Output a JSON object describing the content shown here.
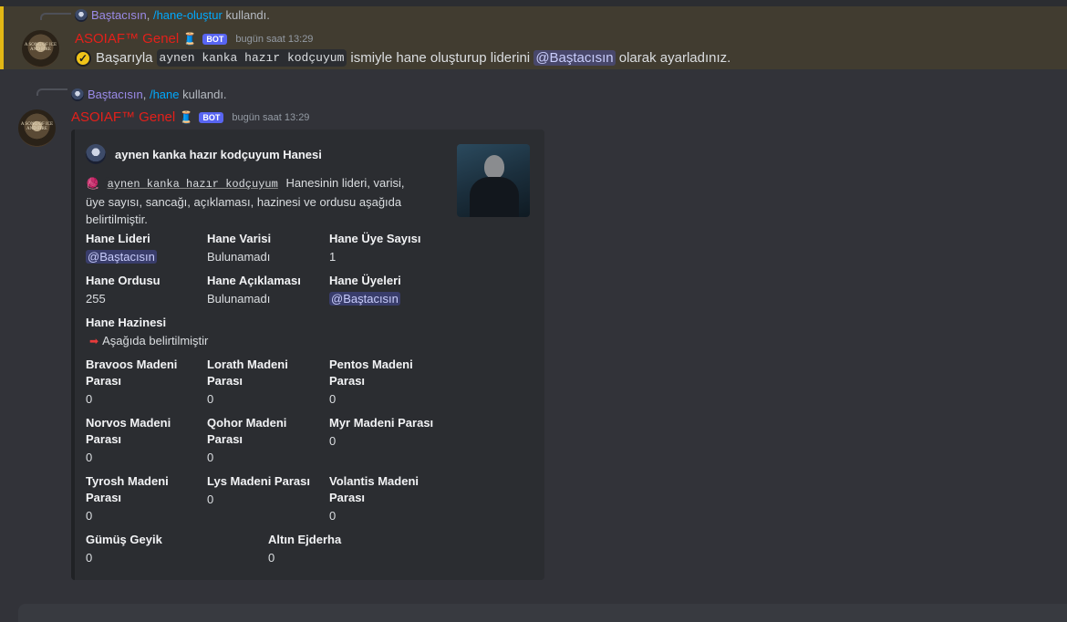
{
  "msg1": {
    "reply_user": "Baştacısın",
    "reply_sep": ",",
    "reply_cmd": "/hane-oluştur",
    "reply_suffix": "kullandı.",
    "author": "ASOIAF™ Genel",
    "bot_badge": "BOT",
    "timestamp": "bugün saat 13:29",
    "text_before": "Başarıyla",
    "house_code": "aynen kanka hazır kodçuyum",
    "text_middle": "ismiyle hane oluşturup liderini",
    "mention": "@Baştacısın",
    "text_after": "olarak ayarladınız."
  },
  "msg2": {
    "reply_user": "Baştacısın",
    "reply_sep": ",",
    "reply_cmd": "/hane",
    "reply_suffix": "kullandı.",
    "author": "ASOIAF™ Genel",
    "bot_badge": "BOT",
    "timestamp": "bugün saat 13:29"
  },
  "embed": {
    "author": "aynen kanka hazır kodçuyum Hanesi",
    "desc_code": "aynen kanka hazır kodçuyum",
    "desc_text": "Hanesinin lideri, varisi, üye sayısı, sancağı, açıklaması, hazinesi ve ordusu aşağıda belirtilmiştir.",
    "fields": {
      "leader": {
        "name": "Hane Lideri",
        "value": "@Baştacısın"
      },
      "heir": {
        "name": "Hane Varisi",
        "value": "Bulunamadı"
      },
      "member_count": {
        "name": "Hane Üye Sayısı",
        "value": "1"
      },
      "army": {
        "name": "Hane Ordusu",
        "value": "255"
      },
      "description": {
        "name": "Hane Açıklaması",
        "value": "Bulunamadı"
      },
      "members": {
        "name": "Hane Üyeleri",
        "value": "@Baştacısın"
      },
      "treasury": {
        "name": "Hane Hazinesi",
        "value": "Aşağıda belirtilmiştir"
      },
      "braavos": {
        "name": "Bravoos Madeni Parası",
        "value": "0"
      },
      "lorath": {
        "name": "Lorath Madeni Parası",
        "value": "0"
      },
      "pentos": {
        "name": "Pentos Madeni Parası",
        "value": "0"
      },
      "norvos": {
        "name": "Norvos Madeni Parası",
        "value": "0"
      },
      "qohor": {
        "name": "Qohor Madeni Parası",
        "value": "0"
      },
      "myr": {
        "name": "Myr Madeni Parası",
        "value": "0"
      },
      "tyrosh": {
        "name": "Tyrosh Madeni Parası",
        "value": "0"
      },
      "lys": {
        "name": "Lys Madeni Parası",
        "value": "0"
      },
      "volantis": {
        "name": "Volantis Madeni Parası",
        "value": "0"
      },
      "silver_stag": {
        "name": "Gümüş Geyik",
        "value": "0"
      },
      "gold_dragon": {
        "name": "Altın Ejderha",
        "value": "0"
      }
    }
  },
  "avatar_text": "A SONG OF ICE AND FIRE",
  "icons": {
    "verified": "check-badge-icon",
    "arrow": "right-arrow-icon",
    "spool": "thread-spool-icon"
  },
  "colors": {
    "author": "#e4201a",
    "bot_badge": "#5865f2",
    "highlight_border": "#e2b714",
    "command": "#00a8fc",
    "reply_user": "#9b8be8"
  }
}
